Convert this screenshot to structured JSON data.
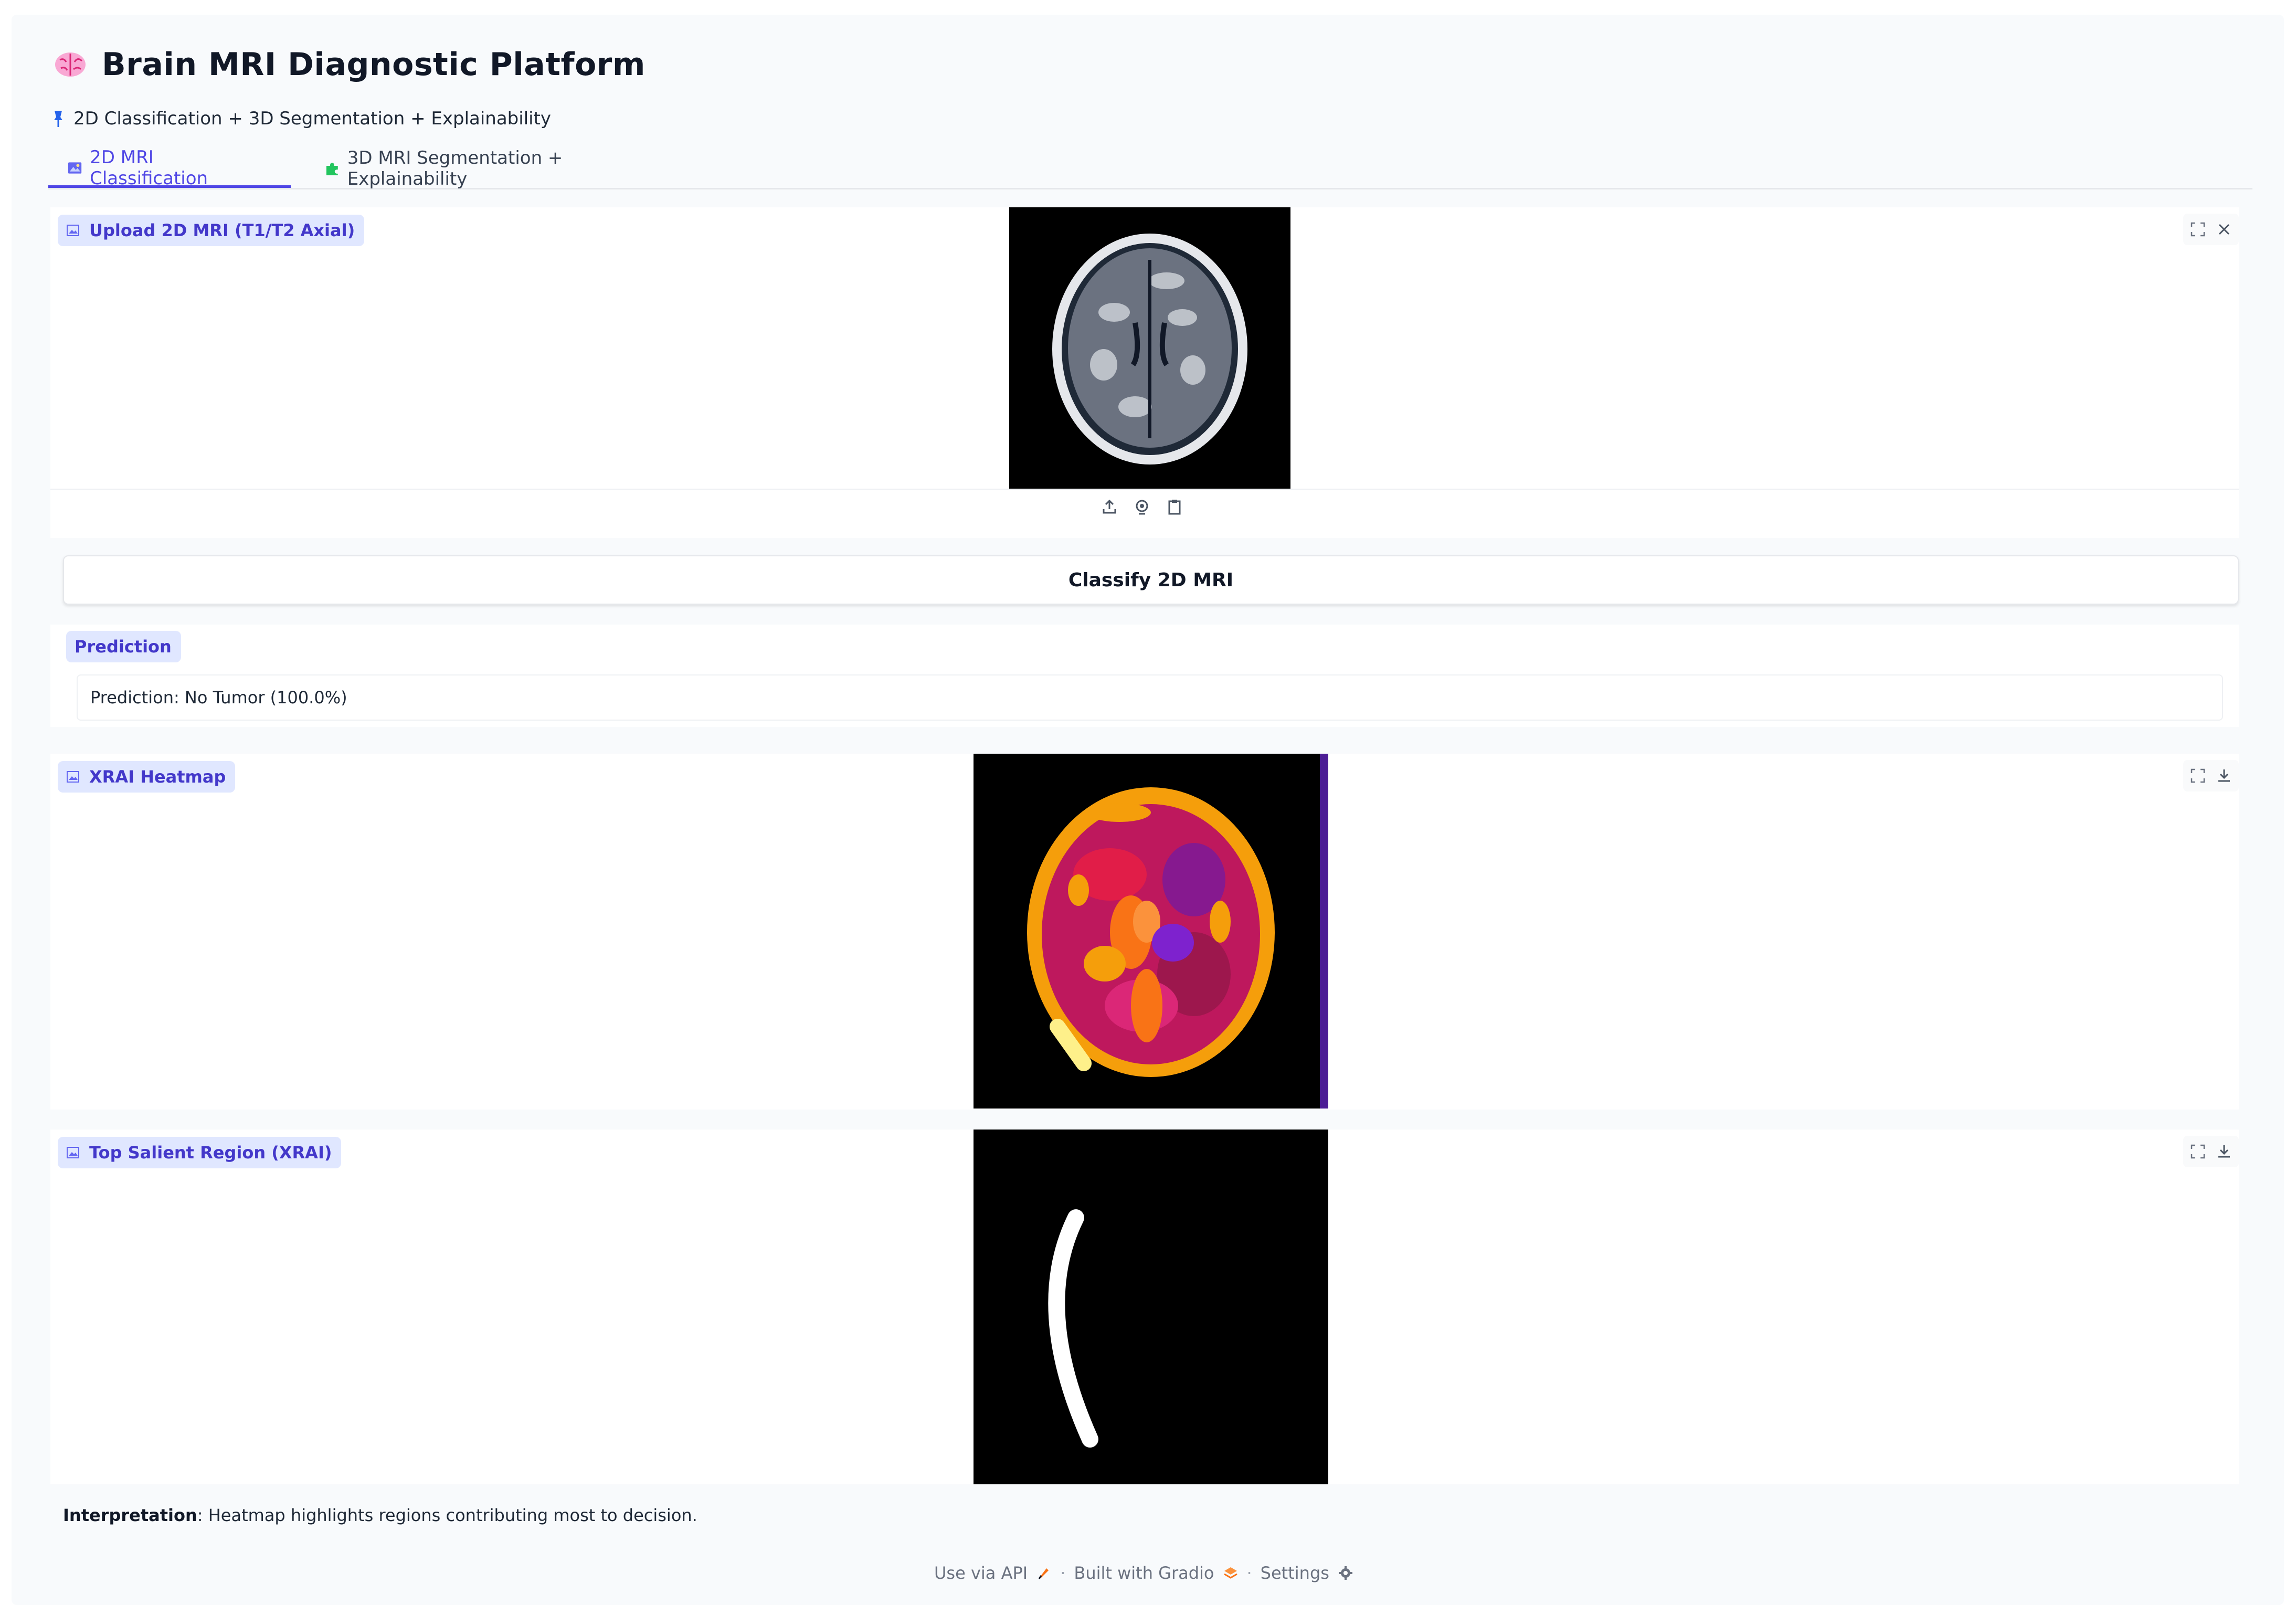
{
  "header": {
    "title": "Brain MRI Diagnostic Platform",
    "subtitle": "2D Classification + 3D Segmentation + Explainability"
  },
  "tabs": [
    {
      "label": "2D MRI Classification",
      "active": true
    },
    {
      "label": "3D MRI Segmentation + Explainability",
      "active": false
    }
  ],
  "upload": {
    "label": "Upload 2D MRI (T1/T2 Axial)"
  },
  "classify_button": "Classify 2D MRI",
  "prediction": {
    "label": "Prediction",
    "value": "Prediction: No Tumor (100.0%)"
  },
  "heatmap": {
    "label": "XRAI Heatmap"
  },
  "salient": {
    "label": "Top Salient Region (XRAI)"
  },
  "interpretation": {
    "bold": "Interpretation",
    "text": ": Heatmap highlights regions contributing most to decision."
  },
  "footer": {
    "api": "Use via API",
    "built": "Built with Gradio",
    "settings": "Settings",
    "separator": "·"
  },
  "colors": {
    "accent": "#4f46e5",
    "label_bg": "#e0e7ff",
    "label_text": "#4338ca"
  },
  "icons": {
    "title": "brain-icon",
    "subtitle": "pin-icon",
    "tab_1": "image-icon",
    "tab_2": "puzzle-icon",
    "image_label": "image-icon",
    "fullscreen": "fullscreen-icon",
    "clear": "close-icon",
    "download": "download-icon",
    "upload": "upload-icon",
    "webcam": "webcam-icon",
    "clipboard": "clipboard-icon",
    "api": "rocket-icon",
    "gradio": "gradio-logo-icon",
    "settings": "gear-icon"
  }
}
